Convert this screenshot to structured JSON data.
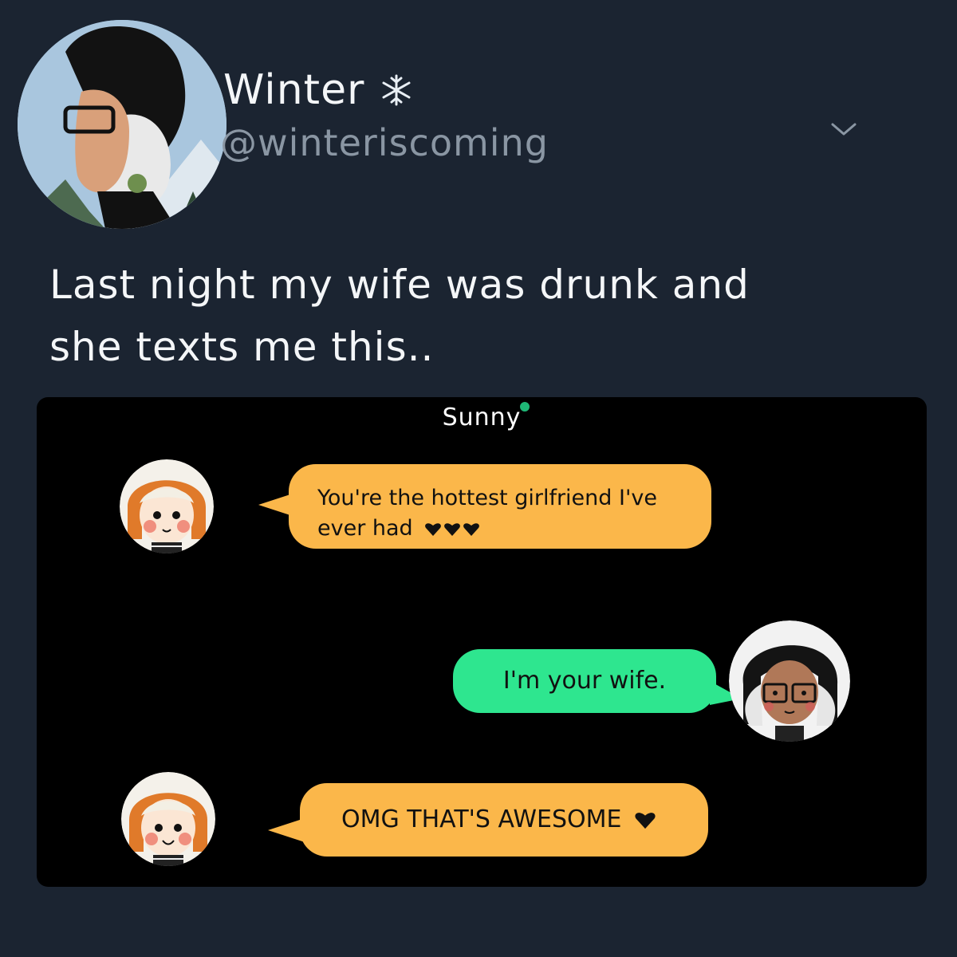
{
  "tweet": {
    "author": {
      "display_name": "Winter",
      "handle": "@winteriscoming",
      "name_emoji_icon": "snowflake-icon",
      "avatar_icon": "profile-avatar"
    },
    "menu_icon": "chevron-down-icon",
    "text_lines": [
      "Last night my wife was drunk and",
      "she texts me this.."
    ]
  },
  "chat": {
    "contact_name": "Sunny",
    "status_color": "#1fb877",
    "messages": [
      {
        "from": "Sunny",
        "side": "left",
        "lines": [
          "You're the hottest girlfriend I've",
          "ever had"
        ],
        "hearts": 3,
        "bubble_color": "#fbb74a"
      },
      {
        "from": "me",
        "side": "right",
        "lines": [
          "I'm your wife."
        ],
        "hearts": 0,
        "bubble_color": "#2ee68f"
      },
      {
        "from": "Sunny",
        "side": "left",
        "lines": [
          "OMG THAT'S AWESOME"
        ],
        "hearts": 1,
        "bubble_color": "#fbb74a"
      }
    ]
  },
  "colors": {
    "background": "#1b2431",
    "chat_background": "#000000",
    "handle_text": "#8a96a3"
  }
}
